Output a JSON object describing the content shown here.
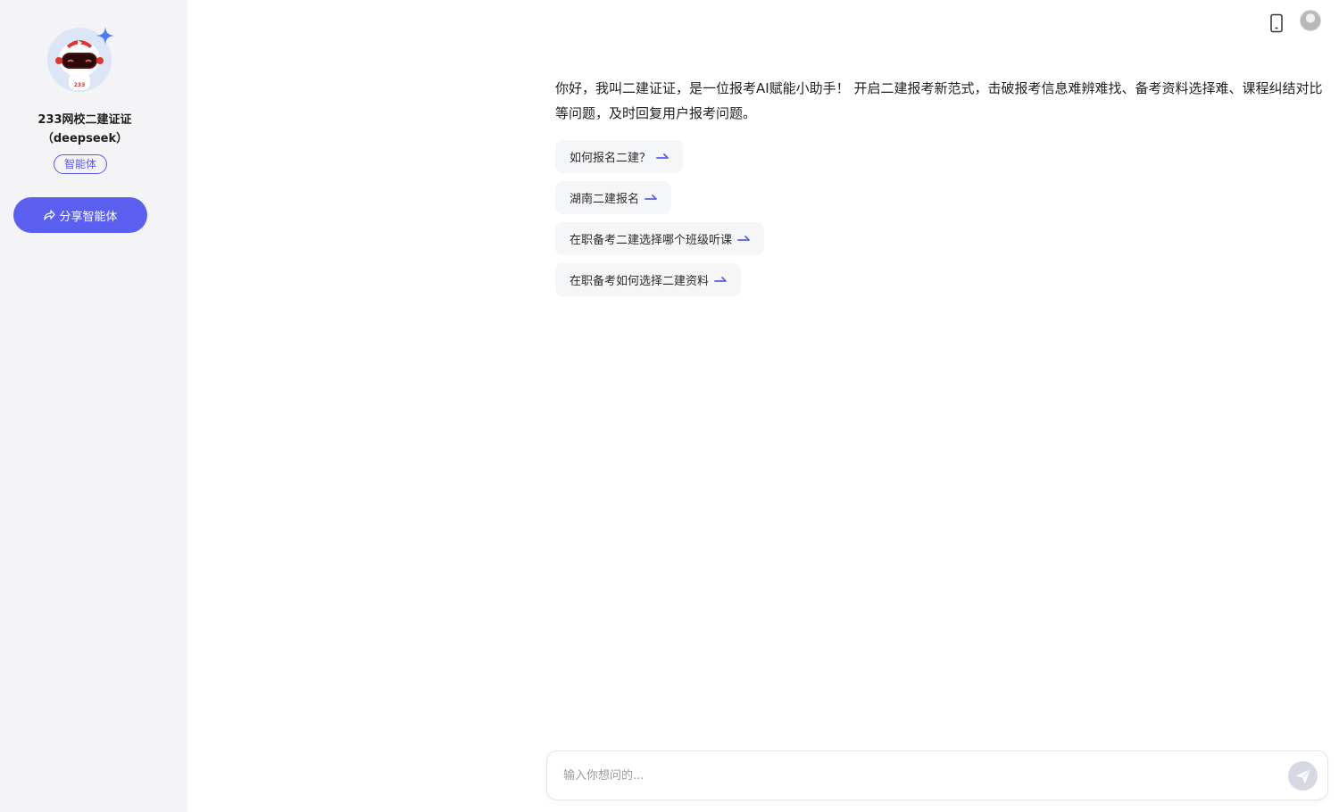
{
  "sidebar": {
    "agent_name_line1": "233网校二建证证",
    "agent_name_line2": "（deepseek）",
    "tag": "智能体",
    "share_label": "分享智能体",
    "avatar_badge_text": "233"
  },
  "main": {
    "intro": "你好，我叫二建证证，是一位报考AI赋能小助手！ 开启二建报考新范式，击破报考信息难辨难找、备考资料选择难、课程纠结对比等问题，及时回复用户报考问题。",
    "suggestions": [
      {
        "label": "如何报名二建？"
      },
      {
        "label": "湖南二建报名"
      },
      {
        "label": "在职备考二建选择哪个班级听课"
      },
      {
        "label": "在职备考如何选择二建资料"
      }
    ]
  },
  "input": {
    "placeholder": "输入你想问的..."
  },
  "colors": {
    "accent": "#5b5ff0",
    "sidebar_bg": "#f4f4f6",
    "chip_bg": "#f5f6f8"
  },
  "icons": {
    "share": "share-arrow-icon",
    "phone": "mobile-phone-icon",
    "send": "send-plane-icon",
    "chip_arrow": "arrow-right-icon",
    "sparkle": "sparkle-star-icon"
  }
}
